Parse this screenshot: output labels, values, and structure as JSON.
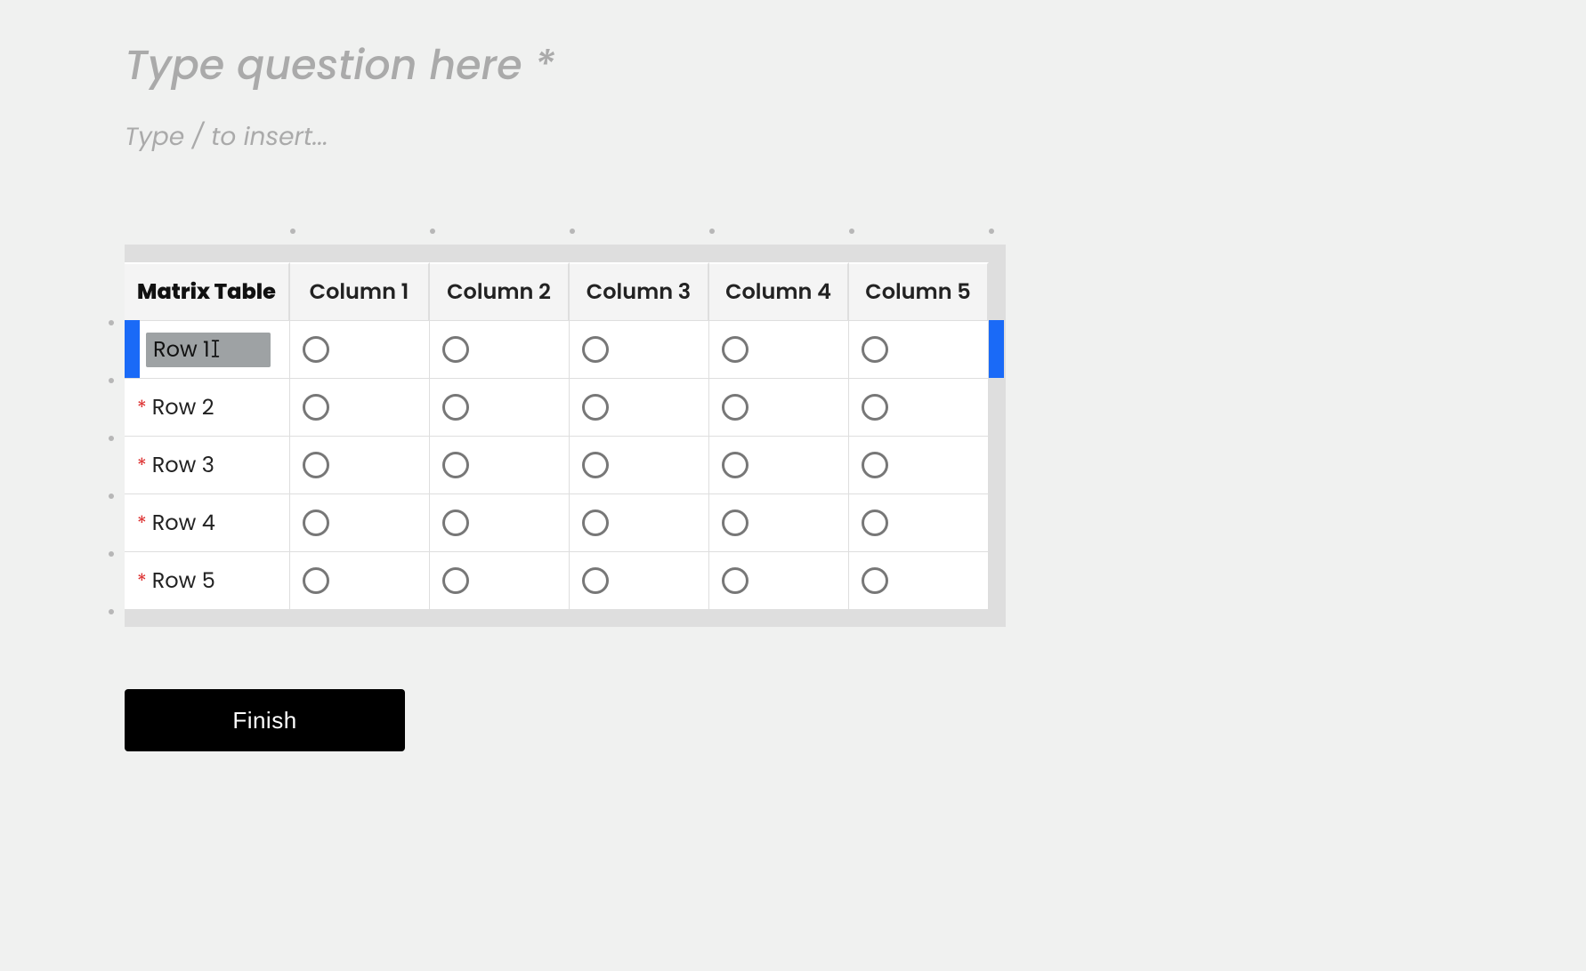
{
  "question": {
    "placeholder": "Type question here",
    "required_marker": "*",
    "insert_hint": "Type / to insert..."
  },
  "matrix": {
    "corner_label": "Matrix Table",
    "columns": [
      "Column 1",
      "Column 2",
      "Column 3",
      "Column 4",
      "Column 5"
    ],
    "rows": [
      {
        "label": "Row 1",
        "required": false,
        "editing": true,
        "selected": true
      },
      {
        "label": "Row 2",
        "required": true,
        "editing": false,
        "selected": false
      },
      {
        "label": "Row 3",
        "required": true,
        "editing": false,
        "selected": false
      },
      {
        "label": "Row 4",
        "required": true,
        "editing": false,
        "selected": false
      },
      {
        "label": "Row 5",
        "required": true,
        "editing": false,
        "selected": false
      }
    ]
  },
  "finish_label": "Finish",
  "colors": {
    "accent": "#1a6af7",
    "required": "#d33"
  }
}
